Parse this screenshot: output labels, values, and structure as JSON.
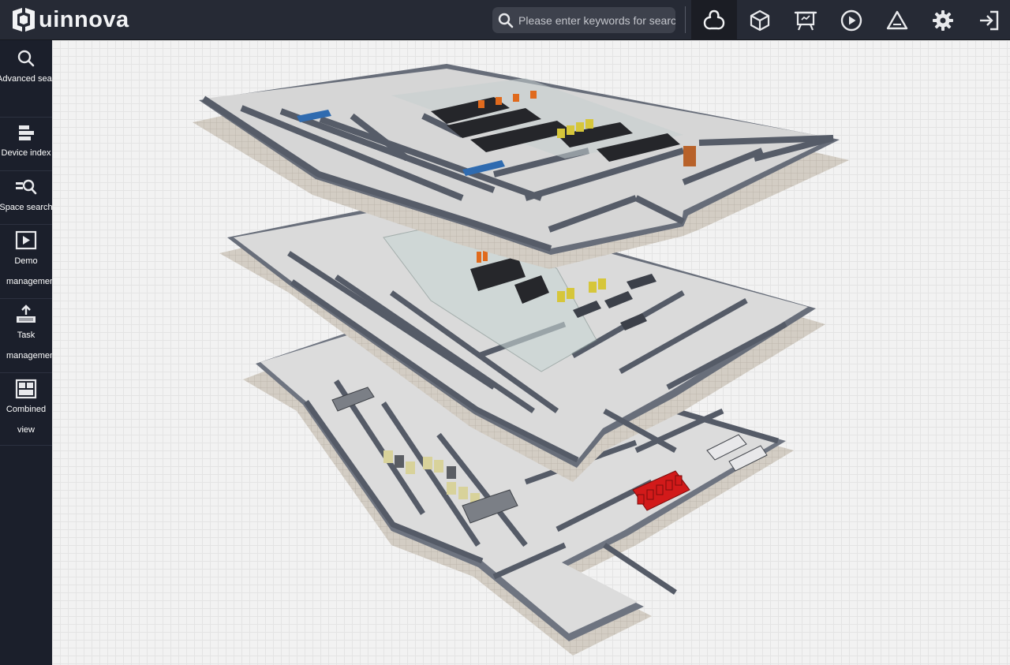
{
  "app": {
    "brand_name": "uinnova",
    "colors": {
      "topbar": "#262a35",
      "sidebar": "#1b1f2b",
      "canvas": "#f2f2f2",
      "icon": "#e8e9ec",
      "wall": "#6f7582",
      "floor_slab": "#c9c4bc",
      "rack": "#2a2a2e",
      "ups": "#d6c63a",
      "fire_cabinet": "#d21a1a"
    }
  },
  "header": {
    "search": {
      "placeholder": "Please enter keywords for search",
      "icon": "search-icon"
    },
    "tools": [
      {
        "name": "topology-icon",
        "active": true
      },
      {
        "name": "cube-icon",
        "active": false
      },
      {
        "name": "presentation-board-icon",
        "active": false
      },
      {
        "name": "play-icon",
        "active": false
      },
      {
        "name": "warning-icon",
        "active": false
      },
      {
        "name": "gear-icon",
        "active": false
      },
      {
        "name": "logout-icon",
        "active": false
      }
    ]
  },
  "sidebar": {
    "items": [
      {
        "label": "Advanced search",
        "icon": "search-icon"
      },
      {
        "label": "Device index",
        "icon": "device-index-icon"
      },
      {
        "label": "Space search",
        "icon": "space-search-icon"
      },
      {
        "label": "Demo management",
        "icon": "demo-icon"
      },
      {
        "label": "Task management",
        "icon": "task-icon"
      },
      {
        "label": "Combined view",
        "icon": "combined-view-icon"
      }
    ]
  },
  "scene": {
    "description_icon": "exploded-building-floors",
    "floors": 3
  }
}
